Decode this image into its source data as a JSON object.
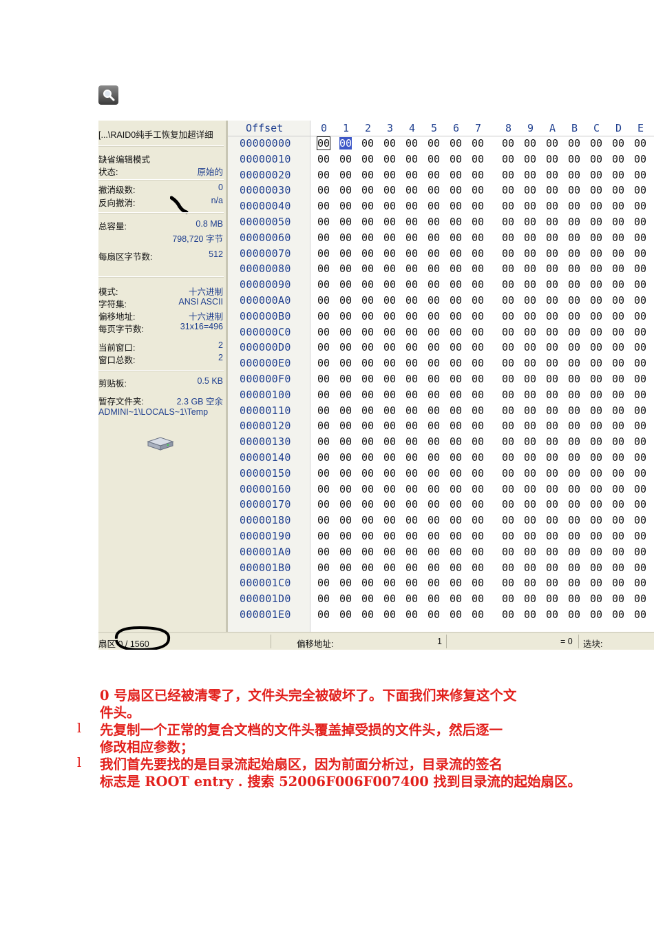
{
  "panel": {
    "path": "[...\\RAID0纯手工恢复加超详细",
    "items": [
      {
        "label": "缺省编辑模式",
        "value": ""
      },
      {
        "label": "状态:",
        "value": "原始的"
      },
      {
        "label": "撤消级数:",
        "value": "0"
      },
      {
        "label": "反向撤消:",
        "value": "n/a"
      },
      {
        "label": "总容量:",
        "value": "0.8 MB"
      },
      {
        "label": "",
        "value": "798,720 字节"
      },
      {
        "label": "每扇区字节数:",
        "value": "512"
      },
      {
        "label": "模式:",
        "value": "十六进制"
      },
      {
        "label": "字符集:",
        "value": "ANSI ASCII"
      },
      {
        "label": "偏移地址:",
        "value": "十六进制"
      },
      {
        "label": "每页字节数:",
        "value": "31x16=496"
      },
      {
        "label": "当前窗口:",
        "value": "2"
      },
      {
        "label": "窗口总数:",
        "value": "2"
      },
      {
        "label": "剪贴板:",
        "value": "0.5 KB"
      },
      {
        "label": "暂存文件夹:",
        "value": "2.3 GB 空余"
      }
    ],
    "temp_path": "ADMINI~1\\LOCALS~1\\Temp"
  },
  "hex": {
    "offset_header": "Offset",
    "columns": [
      "0",
      "1",
      "2",
      "3",
      "4",
      "5",
      "6",
      "7",
      "8",
      "9",
      "A",
      "B",
      "C",
      "D",
      "E"
    ],
    "offsets": [
      "00000000",
      "00000010",
      "00000020",
      "00000030",
      "00000040",
      "00000050",
      "00000060",
      "00000070",
      "00000080",
      "00000090",
      "000000A0",
      "000000B0",
      "000000C0",
      "000000D0",
      "000000E0",
      "000000F0",
      "00000100",
      "00000110",
      "00000120",
      "00000130",
      "00000140",
      "00000150",
      "00000160",
      "00000170",
      "00000180",
      "00000190",
      "000001A0",
      "000001B0",
      "000001C0",
      "000001D0",
      "000001E0"
    ],
    "byte_value": "00",
    "selected_byte": 1
  },
  "status": {
    "sector": "扇区 0 / 1560",
    "offset_label": "偏移地址:",
    "offset_value": "1",
    "equals": "= 0",
    "selection_label": "选块:"
  },
  "text": {
    "p1_line1": "0 号扇区已经被清零了，文件头完全被破坏了。下面我们来修复这个文",
    "p1_line2": "件头。",
    "bullet": "l",
    "p2_line1": "先复制一个正常的复合文档的文件头覆盖掉受损的文件头，然后逐一",
    "p2_line2": "修改相应参数；",
    "p3_line1": "我们首先要找的是目录流起始扇区，因为前面分析过，目录流的签名",
    "p3_line2": "标志是 ROOT entry  . 搜索 52006F006F007400 找到目录流的起始扇区。"
  },
  "colors": {
    "red_text": "#e2201c",
    "hex_blue": "#1f3f8f",
    "panel_bg": "#ecead9",
    "selection": "#3d57c7"
  }
}
